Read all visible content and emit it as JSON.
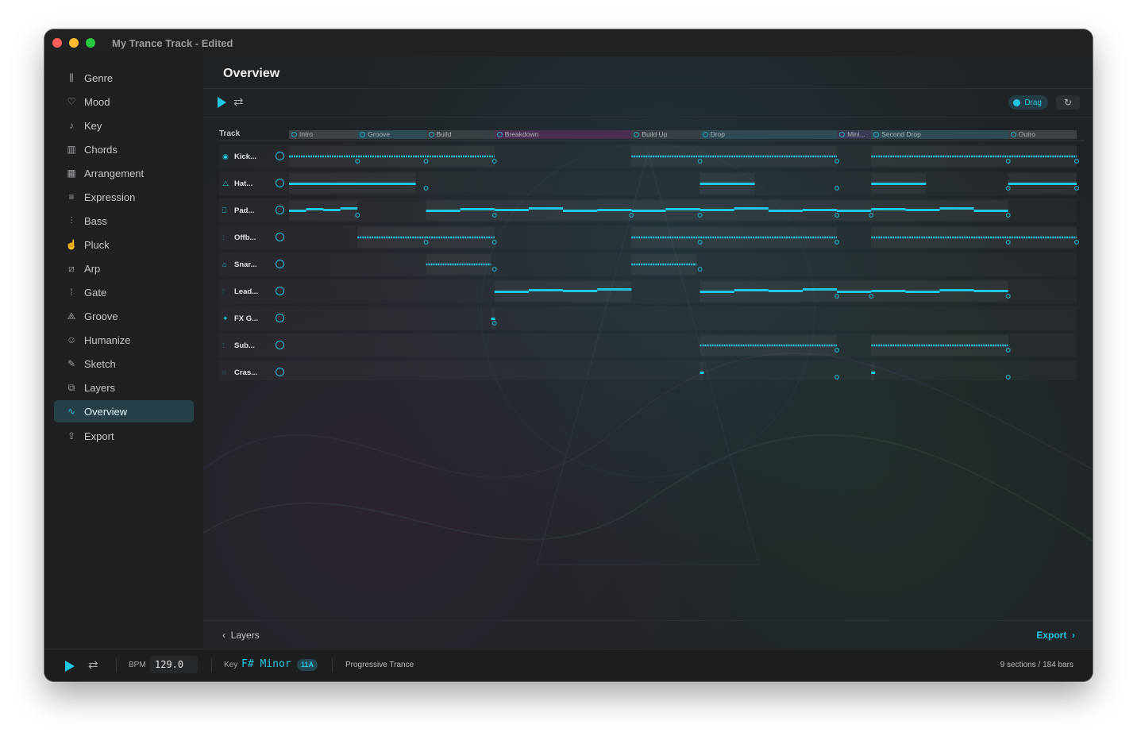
{
  "window": {
    "title": "My Trance Track - Edited"
  },
  "colors": {
    "accent": "#21c6e2",
    "close": "#ff5f57",
    "minimize": "#febc2e",
    "zoom": "#28c840"
  },
  "sidebar": {
    "items": [
      {
        "label": "Genre",
        "icon": "genre-icon",
        "glyph": "⫼"
      },
      {
        "label": "Mood",
        "icon": "mood-icon",
        "glyph": "♡"
      },
      {
        "label": "Key",
        "icon": "key-note-icon",
        "glyph": "♪"
      },
      {
        "label": "Chords",
        "icon": "piano-icon",
        "glyph": "▥"
      },
      {
        "label": "Arrangement",
        "icon": "grid-icon",
        "glyph": "▦"
      },
      {
        "label": "Expression",
        "icon": "sliders-icon",
        "glyph": "≡"
      },
      {
        "label": "Bass",
        "icon": "waveform-icon",
        "glyph": "⫶"
      },
      {
        "label": "Pluck",
        "icon": "hand-icon",
        "glyph": "☝"
      },
      {
        "label": "Arp",
        "icon": "arp-icon",
        "glyph": "⧄"
      },
      {
        "label": "Gate",
        "icon": "gate-icon",
        "glyph": "⁞"
      },
      {
        "label": "Groove",
        "icon": "groove-icon",
        "glyph": "⟁"
      },
      {
        "label": "Humanize",
        "icon": "person-icon",
        "glyph": "☺"
      },
      {
        "label": "Sketch",
        "icon": "pencil-icon",
        "glyph": "✎"
      },
      {
        "label": "Layers",
        "icon": "layers-icon",
        "glyph": "⧉"
      },
      {
        "label": "Overview",
        "icon": "pulse-icon",
        "glyph": "∿",
        "active": true
      },
      {
        "label": "Export",
        "icon": "export-icon",
        "glyph": "⇪"
      }
    ]
  },
  "main": {
    "title": "Overview",
    "toolbar": {
      "drag_label": "Drag",
      "play_icon": "play-icon",
      "loop_icon": "loop-icon",
      "refresh_icon": "refresh-icon"
    },
    "grid": {
      "track_header": "Track",
      "sections": [
        {
          "name": "Intro",
          "start": 0,
          "end": 20,
          "color": "#3d4246"
        },
        {
          "name": "Groove",
          "start": 20,
          "end": 40,
          "color": "#2e4a54"
        },
        {
          "name": "Build",
          "start": 40,
          "end": 60,
          "color": "#3a3f43"
        },
        {
          "name": "Breakdown",
          "start": 60,
          "end": 100,
          "color": "#4a2f52"
        },
        {
          "name": "Build Up",
          "start": 100,
          "end": 120,
          "color": "#3a3f43"
        },
        {
          "name": "Drop",
          "start": 120,
          "end": 160,
          "color": "#2e4a54"
        },
        {
          "name": "Mini...",
          "start": 160,
          "end": 170,
          "color": "#3b3a55"
        },
        {
          "name": "Second Drop",
          "start": 170,
          "end": 210,
          "color": "#2e4a54"
        },
        {
          "name": "Outro",
          "start": 210,
          "end": 230,
          "color": "#3d4246"
        }
      ],
      "tracks": [
        {
          "name": "Kick...",
          "icon": "kick-icon",
          "glyph": "◉",
          "regions": [
            [
              0,
              60,
              "dots"
            ],
            [
              100,
              160,
              "dots"
            ],
            [
              170,
              230,
              "dots"
            ]
          ],
          "markers": [
            20,
            40,
            60,
            120,
            160,
            210,
            230
          ]
        },
        {
          "name": "Hat...",
          "icon": "hat-icon",
          "glyph": "⧍",
          "regions": [
            [
              0,
              37,
              "line"
            ],
            [
              120,
              136,
              "line"
            ],
            [
              170,
              186,
              "line"
            ],
            [
              210,
              230,
              "line"
            ]
          ],
          "markers": [
            40,
            160,
            210,
            230
          ]
        },
        {
          "name": "Pad...",
          "icon": "pad-icon",
          "glyph": "⎕",
          "regions": [
            [
              0,
              20,
              "steps"
            ],
            [
              40,
              210,
              "steps"
            ]
          ],
          "markers": [
            20,
            60,
            100,
            120,
            160,
            170,
            210
          ]
        },
        {
          "name": "Offb...",
          "icon": "offbeat-icon",
          "glyph": "⫶",
          "regions": [
            [
              20,
              60,
              "dots"
            ],
            [
              100,
              160,
              "dots"
            ],
            [
              170,
              230,
              "dots"
            ]
          ],
          "markers": [
            40,
            60,
            120,
            160,
            210,
            230
          ]
        },
        {
          "name": "Snar...",
          "icon": "snare-icon",
          "glyph": "⌂",
          "regions": [
            [
              40,
              59,
              "dots"
            ],
            [
              100,
              119,
              "dots"
            ]
          ],
          "markers": [
            60,
            120
          ]
        },
        {
          "name": "Lead...",
          "icon": "lead-icon",
          "glyph": "⫶",
          "regions": [
            [
              60,
              100,
              "steps"
            ],
            [
              120,
              210,
              "steps"
            ]
          ],
          "markers": [
            160,
            170,
            210
          ]
        },
        {
          "name": "FX G...",
          "icon": "fx-icon",
          "glyph": "✦",
          "regions": [
            [
              59,
              60,
              "line"
            ]
          ],
          "markers": [
            60
          ]
        },
        {
          "name": "Sub...",
          "icon": "sub-icon",
          "glyph": "⫶",
          "regions": [
            [
              120,
              160,
              "dots"
            ],
            [
              170,
              210,
              "dots"
            ]
          ],
          "markers": [
            160,
            210
          ]
        },
        {
          "name": "Cras...",
          "icon": "crash-icon",
          "glyph": "◌",
          "regions": [
            [
              120,
              121,
              "line"
            ],
            [
              170,
              171,
              "line"
            ]
          ],
          "markers": [
            160,
            210
          ]
        }
      ]
    },
    "bottom": {
      "back_label": "Layers",
      "next_label": "Export"
    }
  },
  "statusbar": {
    "bpm_label": "BPM",
    "bpm_value": "129.0",
    "key_label": "Key",
    "key_value": "F# Minor",
    "camelot": "11A",
    "genre": "Progressive Trance",
    "summary": "9 sections / 184 bars"
  }
}
